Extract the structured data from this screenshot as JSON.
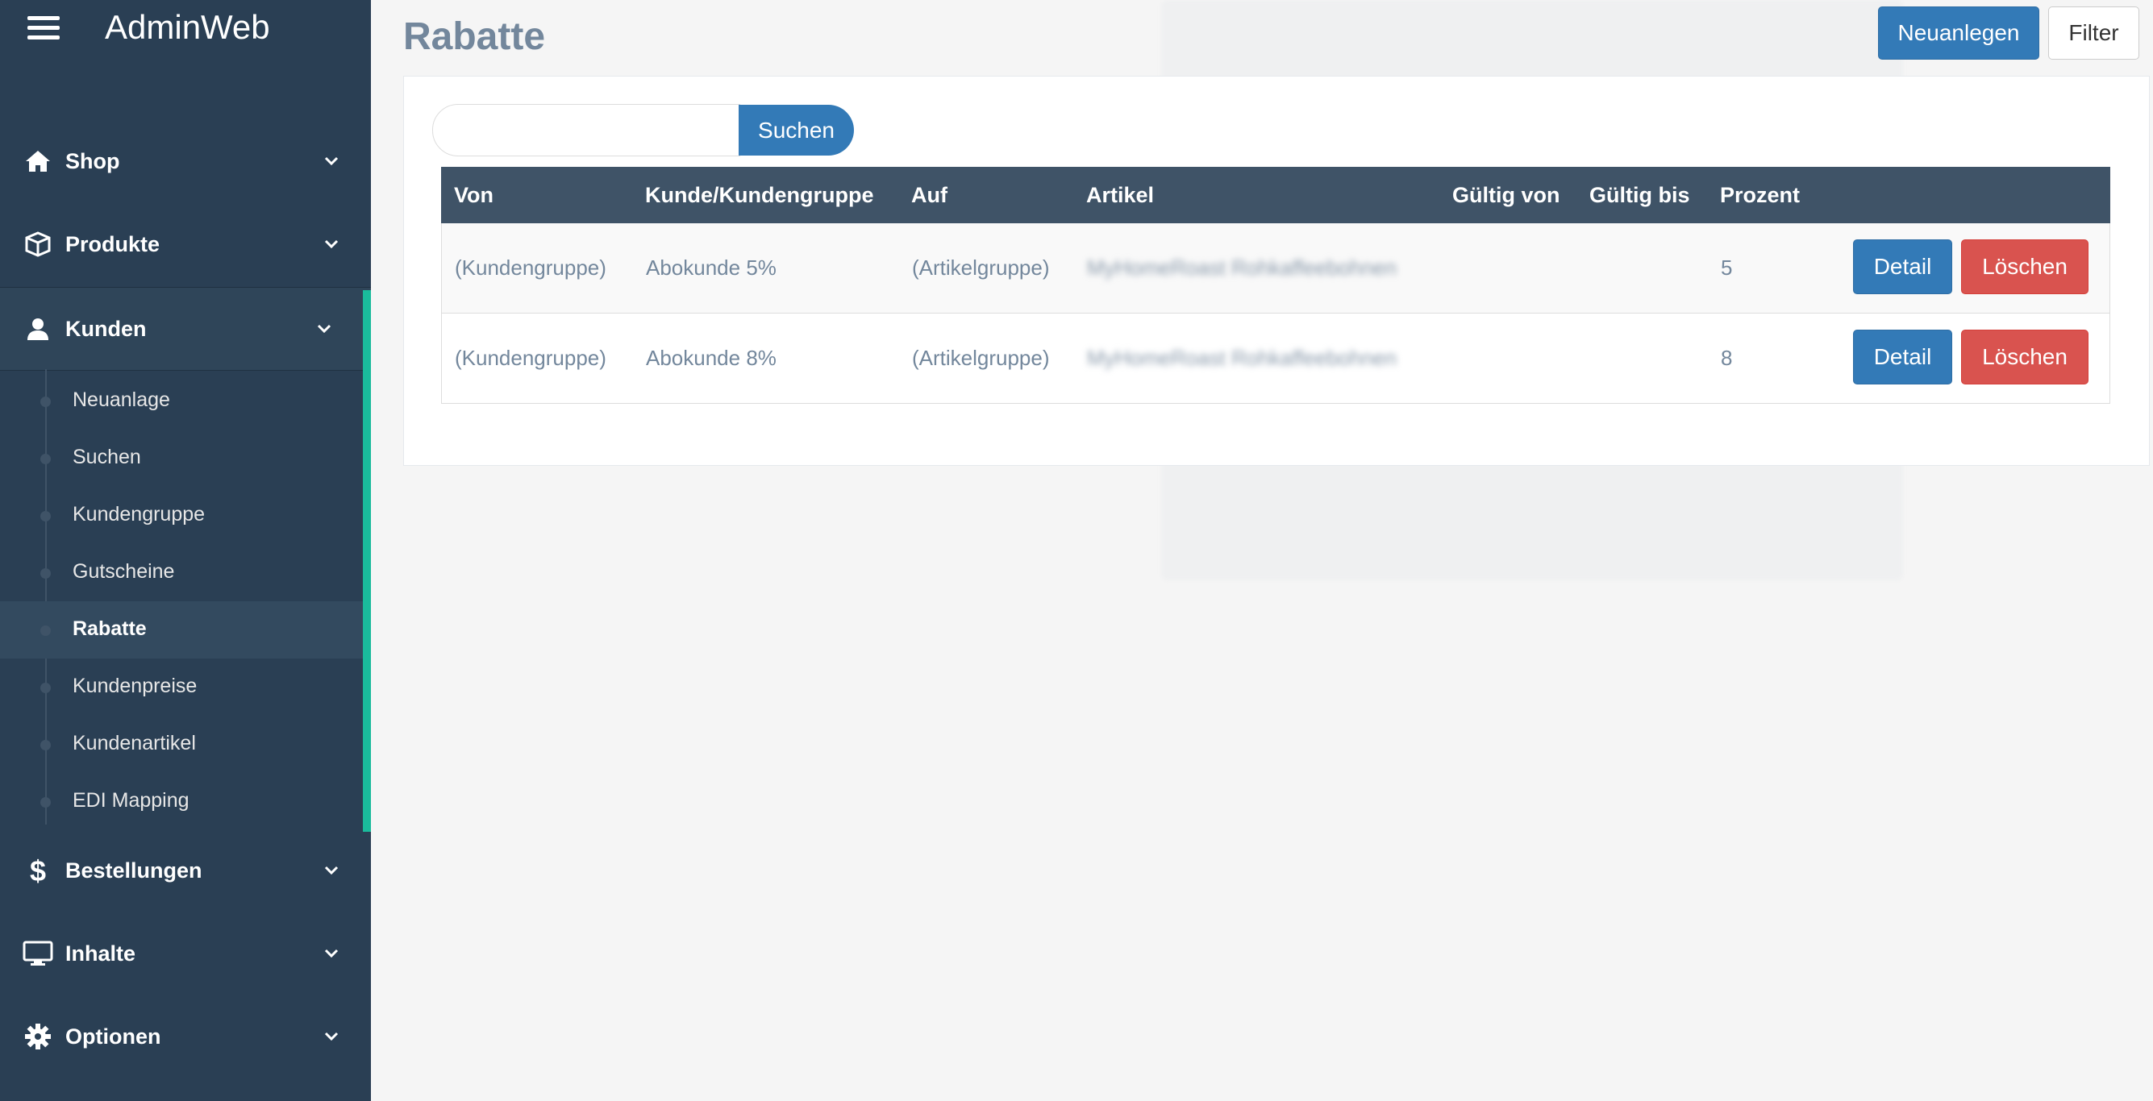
{
  "app": {
    "brand": "AdminWeb"
  },
  "sidebar": {
    "items": [
      {
        "label": "Shop",
        "icon": "home-icon"
      },
      {
        "label": "Produkte",
        "icon": "box-icon"
      },
      {
        "label": "Kunden",
        "icon": "user-icon",
        "expanded": true
      },
      {
        "label": "Bestellungen",
        "icon": "dollar-icon"
      },
      {
        "label": "Inhalte",
        "icon": "monitor-icon"
      },
      {
        "label": "Optionen",
        "icon": "gear-icon"
      }
    ],
    "kunden_sub": [
      {
        "label": "Neuanlage"
      },
      {
        "label": "Suchen"
      },
      {
        "label": "Kundengruppe"
      },
      {
        "label": "Gutscheine"
      },
      {
        "label": "Rabatte",
        "current": true
      },
      {
        "label": "Kundenpreise"
      },
      {
        "label": "Kundenartikel"
      },
      {
        "label": "EDI Mapping"
      }
    ]
  },
  "page": {
    "title": "Rabatte",
    "new_button": "Neuanlegen",
    "filter_button": "Filter"
  },
  "search": {
    "value": "",
    "button": "Suchen"
  },
  "table": {
    "headers": [
      "Von",
      "Kunde/Kundengruppe",
      "Auf",
      "Artikel",
      "Gültig von",
      "Gültig bis",
      "Prozent"
    ],
    "rows": [
      {
        "von": "(Kundengruppe)",
        "kunde": "Abokunde 5%",
        "auf": "(Artikelgruppe)",
        "artikel": "MyHomeRoast Rohkaffeebohnen",
        "gueltig_von": "",
        "gueltig_bis": "",
        "prozent": "5",
        "detail": "Detail",
        "delete": "Löschen"
      },
      {
        "von": "(Kundengruppe)",
        "kunde": "Abokunde 8%",
        "auf": "(Artikelgruppe)",
        "artikel": "MyHomeRoast Rohkaffeebohnen",
        "gueltig_von": "",
        "gueltig_bis": "",
        "prozent": "8",
        "detail": "Detail",
        "delete": "Löschen"
      }
    ]
  },
  "colors": {
    "sidebar_bg": "#2a3f54",
    "accent": "#1abb9c",
    "primary": "#337ab7",
    "danger": "#d9534f",
    "text_muted": "#73879c"
  }
}
